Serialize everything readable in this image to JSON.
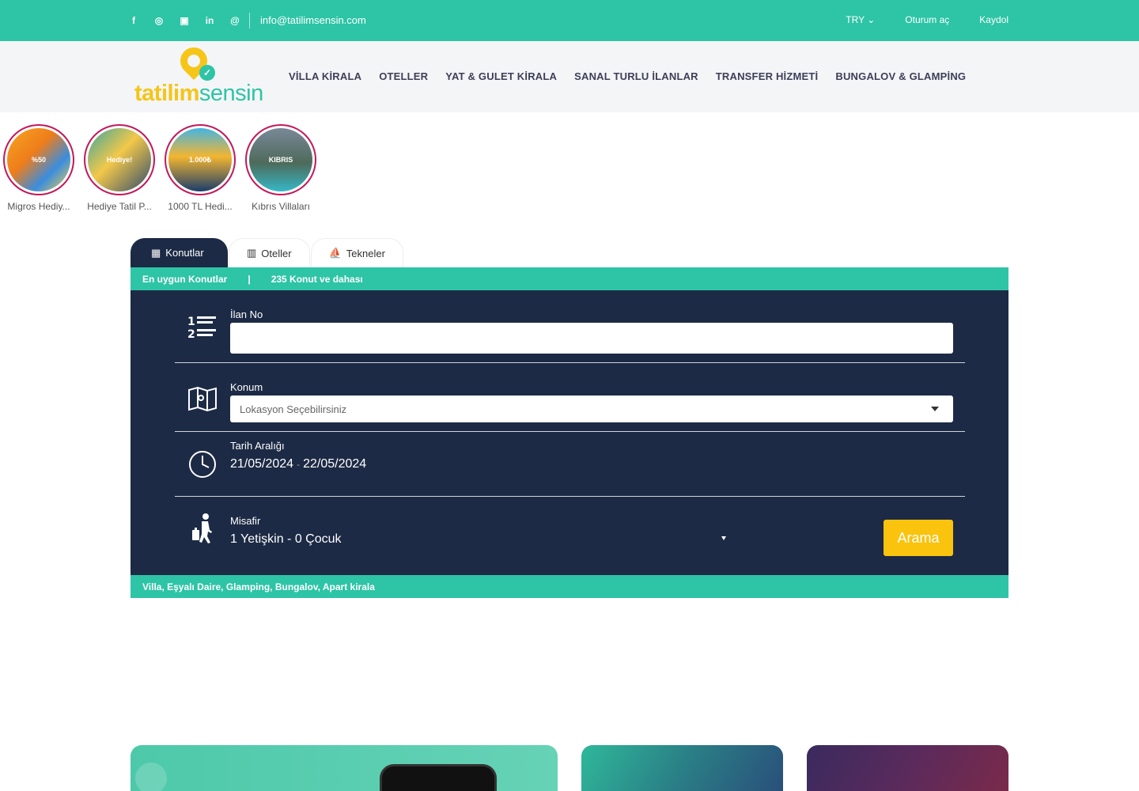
{
  "topbar": {
    "social_icons": [
      "facebook-icon",
      "instagram-icon",
      "youtube-icon",
      "linkedin-icon",
      "email-icon"
    ],
    "email": "info@tatilimsensin.com",
    "currency": "TRY",
    "login": "Oturum aç",
    "register": "Kaydol"
  },
  "header": {
    "logo_part1": "tatilim",
    "logo_part2": "sensin",
    "nav": [
      "VİLLA KİRALA",
      "OTELLER",
      "YAT & GULET KİRALA",
      "SANAL TURLU İLANLAR",
      "TRANSFER HİZMETİ",
      "BUNGALOV & GLAMPİNG"
    ]
  },
  "stories": [
    {
      "label": "Migros Hediy...",
      "image_text": "%50"
    },
    {
      "label": "Hediye Tatil P...",
      "image_text": "Hediye!"
    },
    {
      "label": "1000 TL Hedi...",
      "image_text": "1.000₺"
    },
    {
      "label": "Kıbrıs Villaları",
      "image_text": "KIBRIS"
    }
  ],
  "tabs": [
    {
      "label": "Konutlar",
      "icon": "building-icon"
    },
    {
      "label": "Oteller",
      "icon": "hotel-icon"
    },
    {
      "label": "Tekneler",
      "icon": "sailboat-icon"
    }
  ],
  "search": {
    "strip_left": "En uygun Konutlar",
    "strip_pipe": "|",
    "strip_right": "235 Konut ve dahası",
    "listing_label": "İlan No",
    "listing_value": "",
    "location_label": "Konum",
    "location_placeholder": "Lokasyon Seçebilirsiniz",
    "date_label": "Tarih Aralığı",
    "date_start": "21/05/2024",
    "date_sep": "-",
    "date_end": "22/05/2024",
    "guest_label": "Misafir",
    "guest_value": "1 Yetişkin - 0 Çocuk",
    "search_button": "Arama",
    "bottom_strip": "Villa, Eşyalı Daire, Glamping, Bungalov, Apart kirala"
  },
  "colors": {
    "accent": "#2ec4a6",
    "panel": "#1c2a45",
    "button": "#f9c30e"
  }
}
